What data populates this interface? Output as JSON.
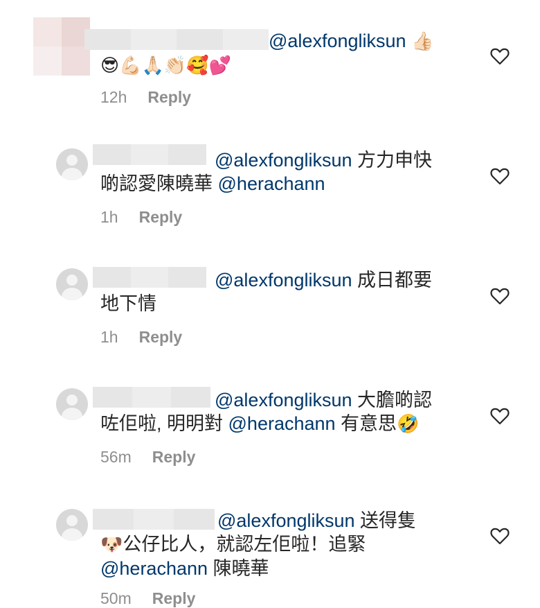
{
  "comments": [
    {
      "mention": "@alexfongliksun",
      "text_after": "",
      "emoji_line_1": "👍🏻",
      "emoji_line_2": "😎💪🏻🙏🏻👏🏻🥰💕",
      "time": "12h",
      "reply_label": "Reply"
    },
    {
      "mention": "@alexfongliksun",
      "text_after": " 方力申快",
      "line2_text": "啲認愛陳曉華 ",
      "mention2": "@herachann",
      "time": "1h",
      "reply_label": "Reply"
    },
    {
      "mention": "@alexfongliksun",
      "text_after": " 成日都要",
      "line2_text": "地下情",
      "time": "1h",
      "reply_label": "Reply"
    },
    {
      "mention": "@alexfongliksun",
      "text_after": " 大膽啲認",
      "line2_text": "咗佢啦, 明明對 ",
      "mention2": "@herachann",
      "line2_after": " 有意思",
      "emoji_end": "🤣",
      "time": "56m",
      "reply_label": "Reply"
    },
    {
      "mention": "@alexfongliksun",
      "text_after": " 送得隻",
      "emoji_dog": "🐶",
      "line2_text": "公仔比人，就認左佢啦！追緊",
      "mention2": "@herachann",
      "line3_text": " 陳曉華",
      "time": "50m",
      "reply_label": "Reply"
    }
  ],
  "icons": {
    "like": "heart-outline-icon"
  },
  "colors": {
    "text": "#262626",
    "mention": "#00376b",
    "meta": "#8e8e8e"
  }
}
